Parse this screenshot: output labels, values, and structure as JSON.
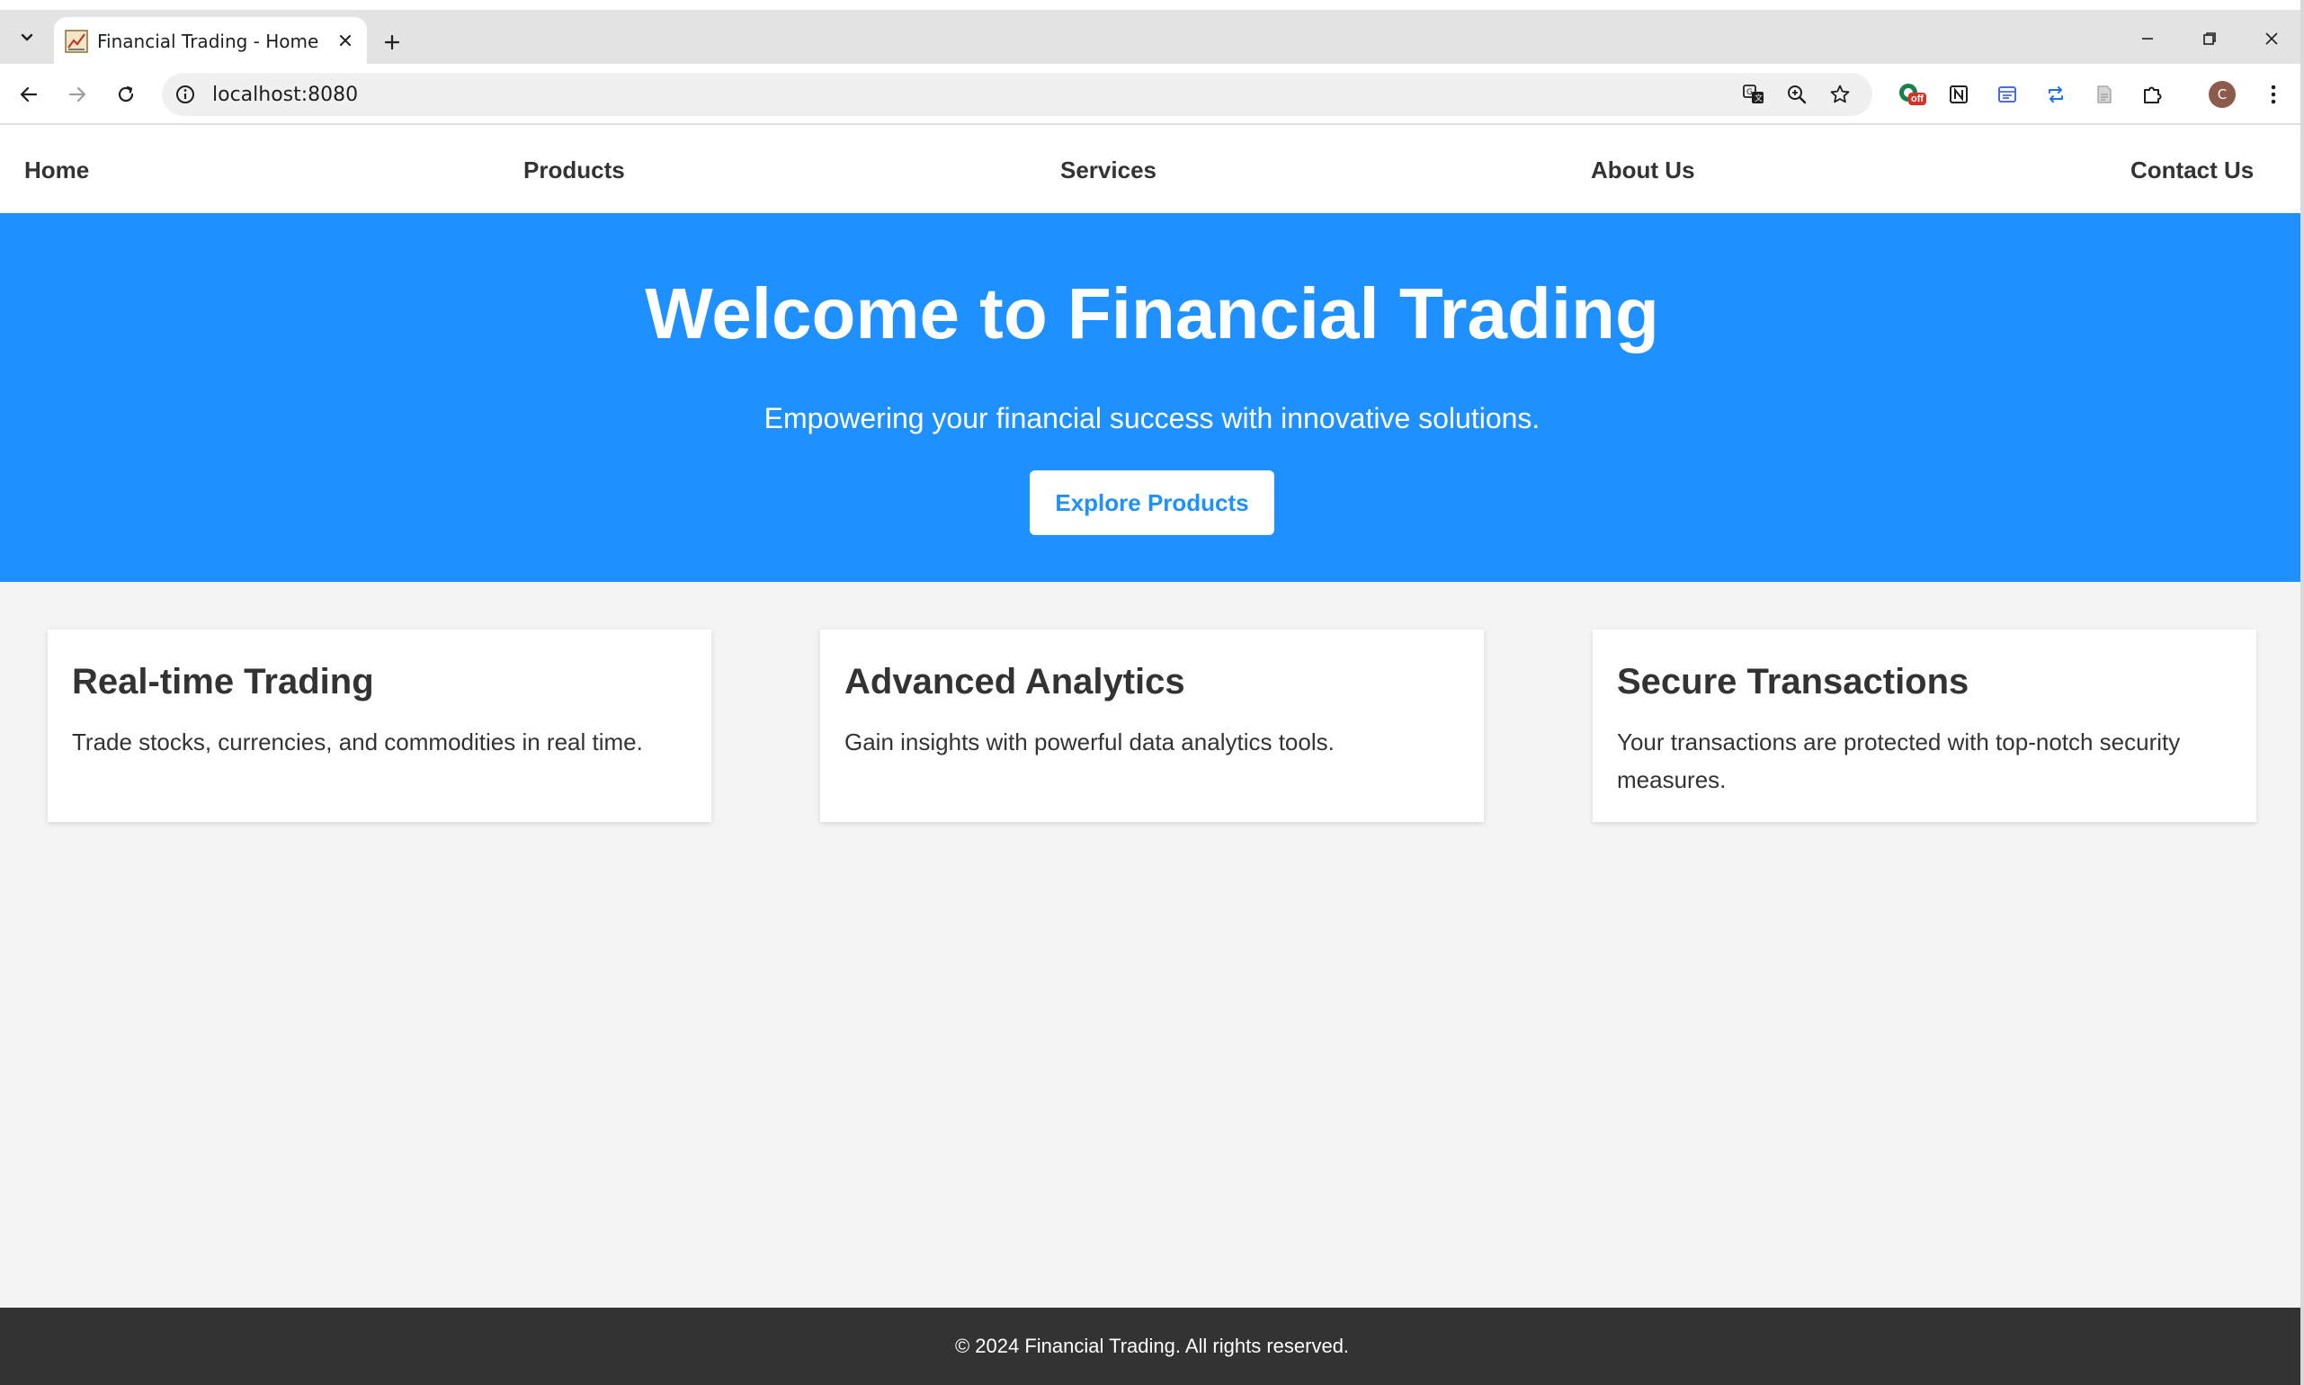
{
  "browser": {
    "tab_title": "Financial Trading - Home",
    "url": "localhost:8080",
    "extension_badge": "off",
    "profile_initial": "C"
  },
  "nav": {
    "home": "Home",
    "products": "Products",
    "services": "Services",
    "about": "About Us",
    "contact": "Contact Us"
  },
  "hero": {
    "title": "Welcome to Financial Trading",
    "subtitle": "Empowering your financial success with innovative solutions.",
    "button": "Explore Products"
  },
  "features": [
    {
      "title": "Real-time Trading",
      "text": "Trade stocks, currencies, and commodities in real time."
    },
    {
      "title": "Advanced Analytics",
      "text": "Gain insights with powerful data analytics tools."
    },
    {
      "title": "Secure Transactions",
      "text": "Your transactions are protected with top-notch security measures."
    }
  ],
  "footer": {
    "text": "© 2024 Financial Trading. All rights reserved."
  },
  "colors": {
    "hero_bg": "#1e90ff",
    "page_bg": "#f4f4f4",
    "footer_bg": "#333333",
    "text": "#333333"
  }
}
